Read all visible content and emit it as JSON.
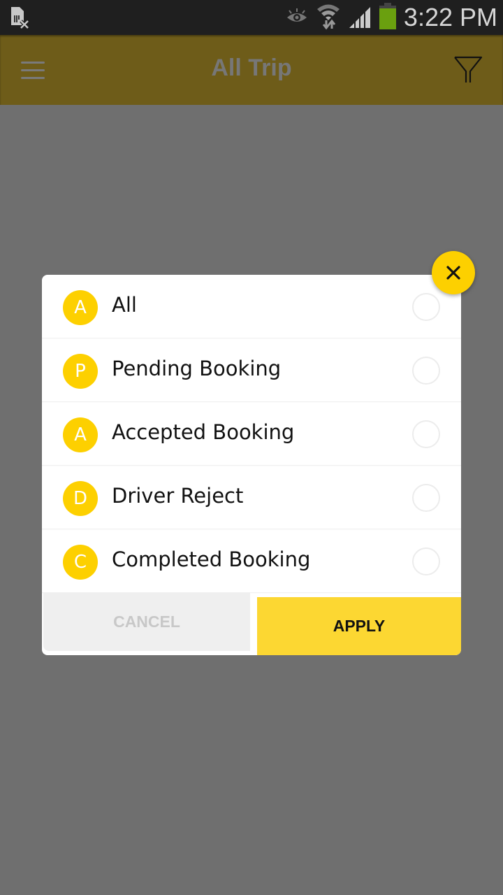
{
  "status_bar": {
    "time": "3:22 PM",
    "icons": [
      "no-sim-icon",
      "eye-icon",
      "wifi-icon",
      "signal-icon",
      "battery-icon"
    ],
    "battery_color": "#6aa00f"
  },
  "app_bar": {
    "title": "All Trip",
    "menu_icon": "hamburger-menu-icon",
    "filter_icon": "filter-funnel-icon"
  },
  "filter_dialog": {
    "close_icon": "close-x-icon",
    "options": [
      {
        "initial": "A",
        "label": "All",
        "selected": false
      },
      {
        "initial": "P",
        "label": "Pending Booking",
        "selected": false
      },
      {
        "initial": "A",
        "label": "Accepted Booking",
        "selected": false
      },
      {
        "initial": "D",
        "label": "Driver Reject",
        "selected": false
      },
      {
        "initial": "C",
        "label": "Completed Booking",
        "selected": false
      }
    ],
    "cancel_label": "CANCEL",
    "apply_label": "APPLY"
  },
  "colors": {
    "accent": "#fdd000",
    "apply_button": "#fcd732",
    "app_bar_dimmed": "#6e5c19",
    "overlay": "#6f6f6f"
  }
}
